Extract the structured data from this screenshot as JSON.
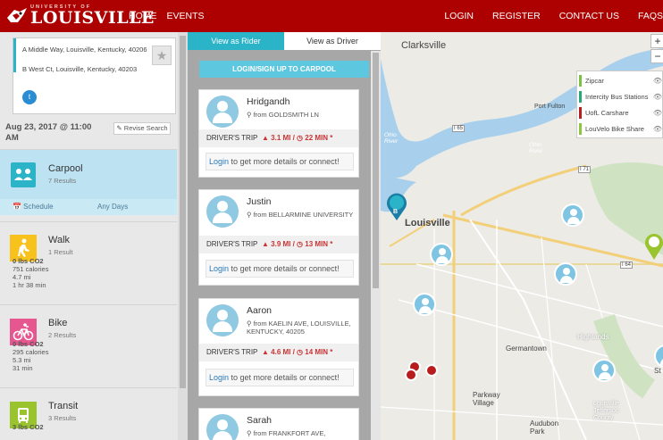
{
  "nav": {
    "logo_small": "UNIVERSITY OF",
    "logo_big": "LOUISVILLE",
    "left": [
      "HOME",
      "EVENTS"
    ],
    "right": [
      "LOGIN",
      "REGISTER",
      "CONTACT US",
      "FAQS"
    ]
  },
  "search": {
    "origin": "A  Middle Way, Louisville, Kentucky, 40206",
    "destination": "B  West Ct, Louisville, Kentucky, 40203",
    "star": "★",
    "twitter": "t",
    "date": "Aug 23, 2017 @ 11:00 AM",
    "revise": "✎ Revise Search"
  },
  "modes": {
    "carpool": {
      "title": "Carpool",
      "sub": "7 Results",
      "schedule": "📅 Schedule",
      "days": "Any Days"
    },
    "walk": {
      "title": "Walk",
      "sub": "1 Result",
      "stats": [
        "0 lbs CO2",
        "751 calories",
        "4.7 mi",
        "1 hr 38 min"
      ]
    },
    "bike": {
      "title": "Bike",
      "sub": "2 Results",
      "stats": [
        "0 lbs CO2",
        "295 calories",
        "5.3 mi",
        "31 min"
      ]
    },
    "transit": {
      "title": "Transit",
      "sub": "3 Results",
      "stats": [
        "3 lbs CO2"
      ]
    }
  },
  "middle": {
    "tab_rider": "View as Rider",
    "tab_driver": "View as Driver",
    "login_button": "LOGIN/SIGN UP TO CARPOOL",
    "trip_label": "DRIVER'S TRIP",
    "login_link": "Login",
    "login_msg": " to get more details or connect!",
    "cards": [
      {
        "name": "Hridgandh",
        "from": "⚲ from GOLDSMITH LN",
        "dist": "▲ 3.1 MI / ◷ 22 MIN *"
      },
      {
        "name": "Justin",
        "from": "⚲ from BELLARMINE UNIVERSITY",
        "dist": "▲ 3.9 MI / ◷ 13 MIN *"
      },
      {
        "name": "Aaron",
        "from": "⚲ from KAELIN AVE, LOUISVILLE, KENTUCKY, 40205",
        "dist": "▲ 4.6 MI / ◷ 14 MIN *"
      },
      {
        "name": "Sarah",
        "from": "⚲ from FRANKFORT AVE,"
      }
    ]
  },
  "map": {
    "labels": [
      "Clarksville",
      "Louisville",
      "Germantown",
      "Parkway Village",
      "Audubon Park",
      "Highlands",
      "Ohio River",
      "Ohio River",
      "Port Fulton",
      "Louisville Jefferson County",
      "St",
      "I 65",
      "I 64",
      "I 71"
    ],
    "zoom_in": "+",
    "zoom_out": "−",
    "pin_b": "B",
    "layers": [
      {
        "name": "Zipcar",
        "color": "#7dc143"
      },
      {
        "name": "Intercity Bus Stations",
        "color": "#27a878"
      },
      {
        "name": "UofL Carshare",
        "color": "#b81c1c"
      },
      {
        "name": "LouVelo Bike Share",
        "color": "#8cc63f"
      }
    ],
    "eye": "👁"
  }
}
